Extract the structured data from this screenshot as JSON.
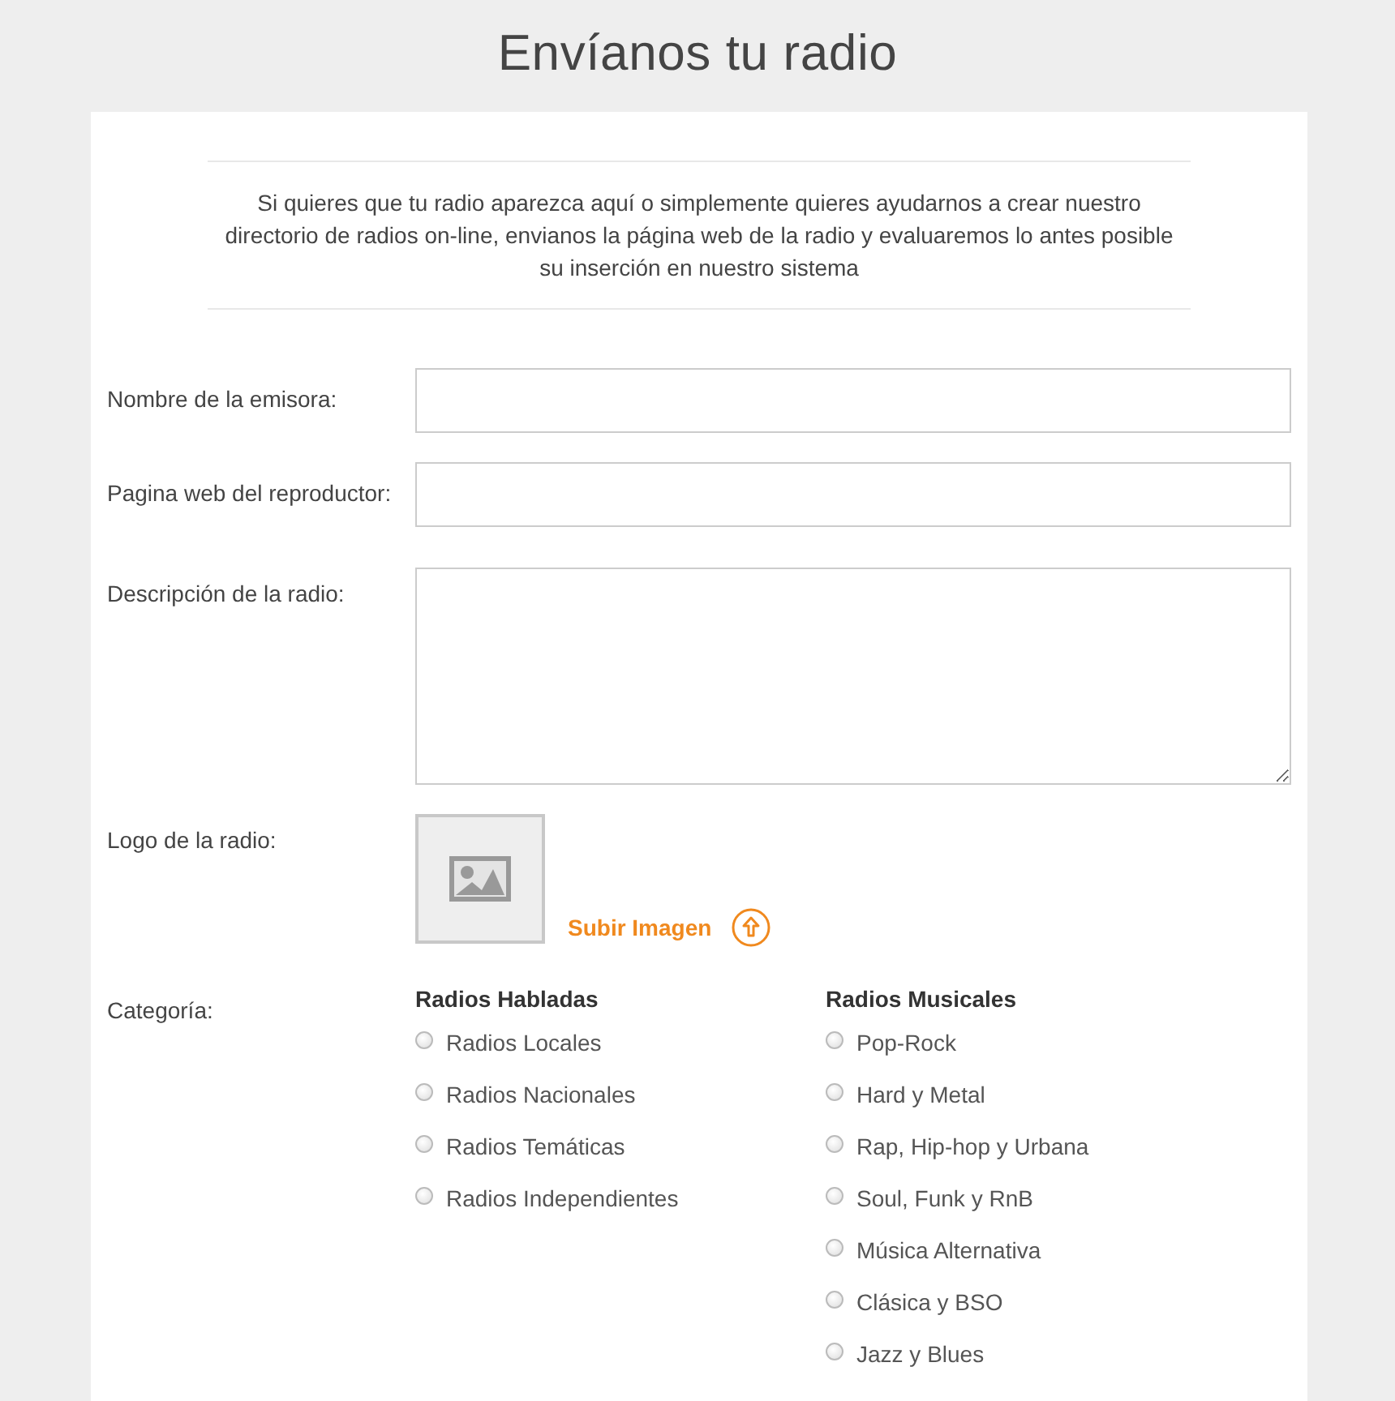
{
  "page": {
    "title": "Envíanos tu radio"
  },
  "intro": "Si quieres que tu radio aparezca aquí o simplemente quieres ayudarnos a crear nuestro directorio de radios on-line, envianos la página web de la radio y evaluaremos lo antes posible su inserción en nuestro sistema",
  "fields": [
    {
      "kind": "text",
      "label": "Nombre de la emisora:"
    },
    {
      "kind": "text",
      "label": "Pagina web del reproductor:"
    },
    {
      "kind": "textarea",
      "label": "Descripción de la radio:"
    },
    {
      "kind": "logo",
      "label": "Logo de la radio:",
      "upload": "Subir Imagen"
    },
    {
      "kind": "categories",
      "label": "Categoría:",
      "groups": [
        {
          "title": "Radios Habladas",
          "options": [
            {
              "label": "Radios Locales",
              "selected": false
            },
            {
              "label": "Radios Nacionales",
              "selected": false
            },
            {
              "label": "Radios Temáticas",
              "selected": false
            },
            {
              "label": "Radios Independientes",
              "selected": false
            }
          ]
        },
        {
          "title": "Radios Musicales",
          "options": [
            {
              "label": "Pop-Rock",
              "selected": false
            },
            {
              "label": "Hard y Metal",
              "selected": false
            },
            {
              "label": "Rap, Hip-hop y Urbana",
              "selected": false
            },
            {
              "label": "Soul, Funk y RnB",
              "selected": false
            },
            {
              "label": "Música Alternativa",
              "selected": false
            },
            {
              "label": "Clásica y BSO",
              "selected": false
            },
            {
              "label": "Jazz y Blues",
              "selected": false
            }
          ]
        }
      ]
    }
  ]
}
